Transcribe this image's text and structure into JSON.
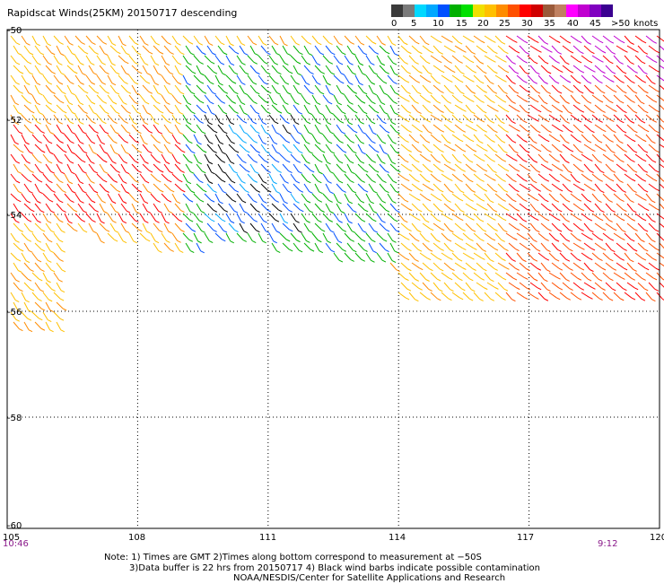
{
  "title": "Rapidscat Winds(25KM) 20150717 descending",
  "legend": {
    "labels": [
      "0",
      "5",
      "10",
      "15",
      "20",
      "25",
      "30",
      "35",
      "40",
      "45",
      ">50"
    ],
    "unit": "knots",
    "colors": [
      "#3a3a3a",
      "#7a7a7a",
      "#00d8ff",
      "#00a8ff",
      "#0050ff",
      "#00b000",
      "#00e000",
      "#f0e000",
      "#ffc000",
      "#ff8c00",
      "#ff5000",
      "#ff0000",
      "#d00000",
      "#9a5a3a",
      "#c08060",
      "#ff00ff",
      "#c000d0",
      "#8000c0",
      "#3a0090"
    ]
  },
  "axes": {
    "lat_labels": [
      "-50",
      "-52",
      "-54",
      "-56",
      "-58",
      "-60"
    ],
    "lon_labels": [
      "105",
      "108",
      "111",
      "114",
      "117",
      "120"
    ],
    "lat_range": [
      -60,
      -50
    ],
    "lon_range": [
      105,
      120
    ]
  },
  "times": {
    "start": "10:46",
    "end": "9:12"
  },
  "notes": [
    "Note: 1) Times are GMT 2)Times along bottom correspond to measurement at −50S",
    "3)Data buffer is 22 hrs from 20150717 4) Black wind barbs indicate possible contamination",
    "NOAA/NESDIS/Center for Satellite Applications and Research"
  ]
}
